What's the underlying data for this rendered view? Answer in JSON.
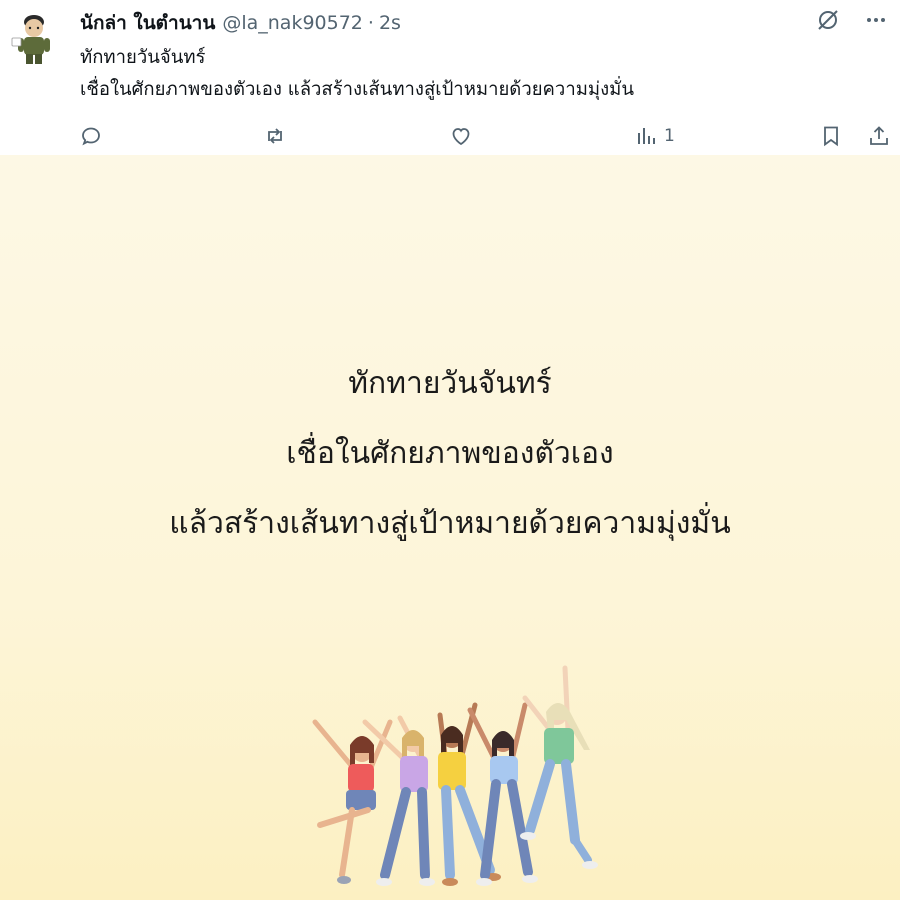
{
  "post": {
    "display_name": "นักล่า ในตำนาน",
    "handle": "@la_nak90572",
    "separator": "·",
    "time": "2s",
    "lines": [
      "ทักทายวันจันทร์",
      "เชื่อในศักยภาพของตัวเอง แล้วสร้างเส้นทางสู่เป้าหมายด้วยความมุ่งมั่น"
    ],
    "top_icons": [
      "grok-icon",
      "more-icon"
    ]
  },
  "actions": {
    "reply_icon": "reply-icon",
    "repost_icon": "repost-icon",
    "like_icon": "heart-icon",
    "views_icon": "views-icon",
    "views_count": "1",
    "bookmark_icon": "bookmark-icon",
    "share_icon": "share-icon"
  },
  "image": {
    "lines": [
      "ทักทายวันจันทร์",
      "เชื่อในศักยภาพของตัวเอง",
      "แล้วสร้างเส้นทางสู่เป้าหมายด้วยความมุ่งมั่น"
    ],
    "illustration": "five women celebrating with raised arms",
    "colors": {
      "background_top": "#fdf8e5",
      "background_bottom": "#fcf0c2"
    }
  }
}
